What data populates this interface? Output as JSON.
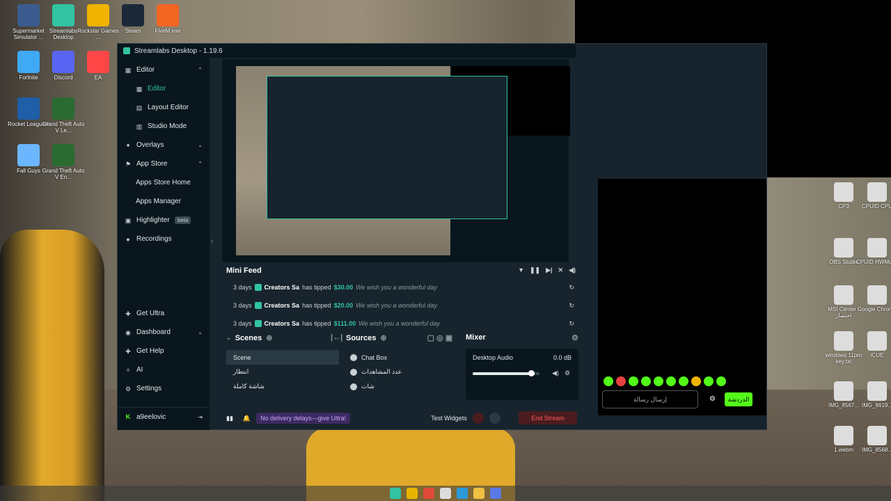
{
  "window": {
    "title": "Streamlabs Desktop - 1.19.6"
  },
  "desktop_icons": [
    {
      "label": "Supermarket Simulator ...",
      "icon": "supermarket-icon",
      "color": "#3b5b8f"
    },
    {
      "label": "Streamlabs Desktop",
      "icon": "streamlabs-icon",
      "color": "#31c3a2"
    },
    {
      "label": "Rockstar Games ...",
      "icon": "rockstar-icon",
      "color": "#f0b400"
    },
    {
      "label": "Steam",
      "icon": "steam-icon",
      "color": "#1b2838"
    },
    {
      "label": "FiveM.exe",
      "icon": "fivem-icon",
      "color": "#f26522"
    },
    {
      "label": "Fortnite",
      "icon": "fortnite-icon",
      "color": "#3fa9f5"
    },
    {
      "label": "Discord",
      "icon": "discord-icon",
      "color": "#5865f2"
    },
    {
      "label": "EA",
      "icon": "ea-icon",
      "color": "#ff4747"
    },
    {
      "label": "Rocket League®",
      "icon": "rocket-league-icon",
      "color": "#1e5fa8"
    },
    {
      "label": "Grand Theft Auto V Le...",
      "icon": "gta-icon",
      "color": "#2a6b32"
    },
    {
      "label": "Fall Guys",
      "icon": "fall-guys-icon",
      "color": "#6bb6ff"
    },
    {
      "label": "Grand Theft Auto V En...",
      "icon": "gta-icon",
      "color": "#2a6b32"
    }
  ],
  "right_desktop_icons": [
    {
      "label": "CP3",
      "icon": "kick-icon"
    },
    {
      "label": "CPUID CPU",
      "icon": "cpuid-icon"
    },
    {
      "label": "OBS Studio",
      "icon": "obs-icon"
    },
    {
      "label": "CPUID HWMonit",
      "icon": "cpuid-icon"
    },
    {
      "label": "MSI Center - اختصار",
      "icon": "file-icon"
    },
    {
      "label": "Google Chrome",
      "icon": "chrome-icon"
    },
    {
      "label": "windows 11pro key.txt",
      "icon": "text-file-icon"
    },
    {
      "label": "iCUE",
      "icon": "icue-icon"
    },
    {
      "label": "IMG_8567...",
      "icon": "image-icon"
    },
    {
      "label": "IMG_8619...",
      "icon": "image-icon"
    },
    {
      "label": "1.webm",
      "icon": "video-icon"
    },
    {
      "label": "IMG_8568...",
      "icon": "image-icon"
    }
  ],
  "sidebar": {
    "items": [
      {
        "label": "Editor",
        "icon": "editor-icon",
        "type": "section",
        "expanded": true
      },
      {
        "label": "Editor",
        "icon": "editor-icon",
        "type": "sub",
        "active": true
      },
      {
        "label": "Layout Editor",
        "icon": "layout-icon",
        "type": "sub"
      },
      {
        "label": "Studio Mode",
        "icon": "studio-mode-icon",
        "type": "sub"
      },
      {
        "label": "Overlays",
        "icon": "overlays-icon",
        "type": "section",
        "expanded": false
      },
      {
        "label": "App Store",
        "icon": "app-store-icon",
        "type": "section",
        "expanded": true
      },
      {
        "label": "Apps Store Home",
        "type": "sub"
      },
      {
        "label": "Apps Manager",
        "type": "sub"
      },
      {
        "label": "Highlighter",
        "icon": "highlighter-icon",
        "type": "section",
        "badge": "beta"
      },
      {
        "label": "Recordings",
        "icon": "recordings-icon",
        "type": "section"
      }
    ],
    "bottom": [
      {
        "label": "Get Ultra",
        "icon": "ultra-icon"
      },
      {
        "label": "Dashboard",
        "icon": "dashboard-icon"
      },
      {
        "label": "Get Help",
        "icon": "help-icon"
      },
      {
        "label": "AI",
        "icon": "ai-icon"
      },
      {
        "label": "Settings",
        "icon": "settings-icon"
      }
    ],
    "user": "a9eelovic"
  },
  "mini_feed": {
    "title": "Mini Feed",
    "rows": [
      {
        "time": "3 days",
        "name": "Creators Sa",
        "action": "has tipped",
        "amount": "$30.00",
        "message": "We wish you a wonderful day"
      },
      {
        "time": "3 days",
        "name": "Creators Sa",
        "action": "has tipped",
        "amount": "$20.00",
        "message": "We wish you a wonderful day"
      },
      {
        "time": "3 days",
        "name": "Creators Sa",
        "action": "has tipped",
        "amount": "$111.00",
        "message": "We wish you a wonderful day"
      }
    ]
  },
  "scenes": {
    "title": "Scenes",
    "items": [
      "Scene",
      "انتظار",
      "شاشة كاملة"
    ],
    "selected": 0
  },
  "sources": {
    "title": "Sources",
    "items": [
      "Chat Box",
      "عدد المشاهدات",
      "شات"
    ]
  },
  "mixer": {
    "title": "Mixer",
    "channel": "Desktop Audio",
    "level": "0.0 dB",
    "volume_fraction": 0.87
  },
  "footer": {
    "promo": "No delivery delays—give Ultra!",
    "test_widgets": "Test Widgets",
    "end_stream": "End Stream"
  },
  "chat": {
    "placeholder": "إرسال رسالة",
    "send_label": "الدردشة"
  }
}
